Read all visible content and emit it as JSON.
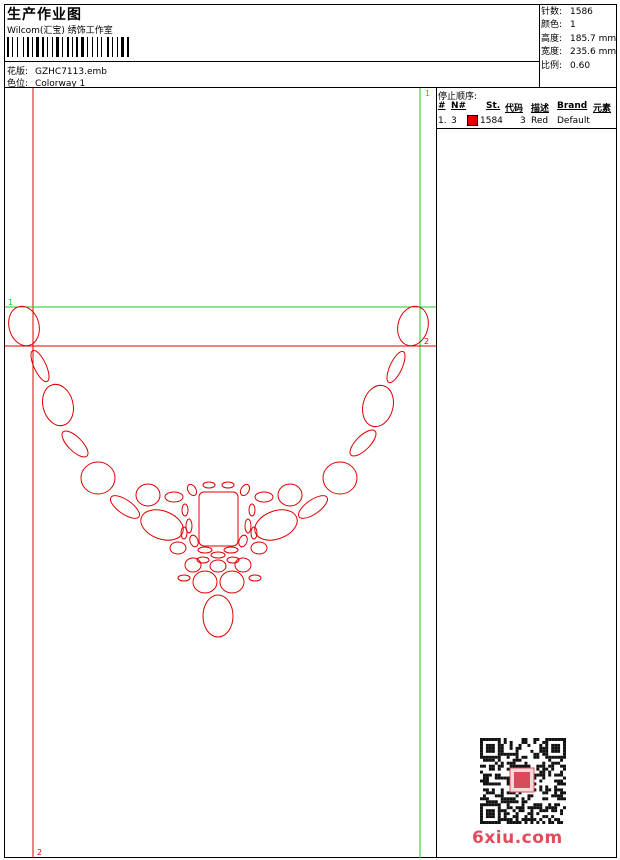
{
  "header": {
    "title": "生产作业图",
    "subtitle": "Wilcom(汇宝) 绣饰工作室",
    "design_label": "花版:",
    "design_value": "GZHC7113.emb",
    "colorway_label": "色位:",
    "colorway_value": "Colorway 1"
  },
  "stats": {
    "stitches_label": "针数:",
    "stitches_value": "1586",
    "colors_label": "颜色:",
    "colors_value": "1",
    "height_label": "高度:",
    "height_value": "185.7 mm",
    "width_label": "宽度:",
    "width_value": "235.6 mm",
    "scale_label": "比例:",
    "scale_value": "0.60"
  },
  "sequence": {
    "title": "停止顺序:",
    "columns": [
      "#",
      "N#",
      "St.",
      "代码",
      "描述",
      "Brand",
      "元素"
    ],
    "rows": [
      {
        "index": "1.",
        "needle": "3",
        "stitches": "1584",
        "code": "3",
        "description": "Red",
        "brand": "Default",
        "color": "#dd0000"
      }
    ]
  },
  "guides": {
    "green_top": "1",
    "green_left": "1",
    "red_right": "2",
    "red_bottom": "2"
  },
  "colors": {
    "design_line": "#dd0000",
    "guide_green": "#22cc22",
    "guide_red": "#dd0000"
  },
  "watermark": "6xiu.com"
}
